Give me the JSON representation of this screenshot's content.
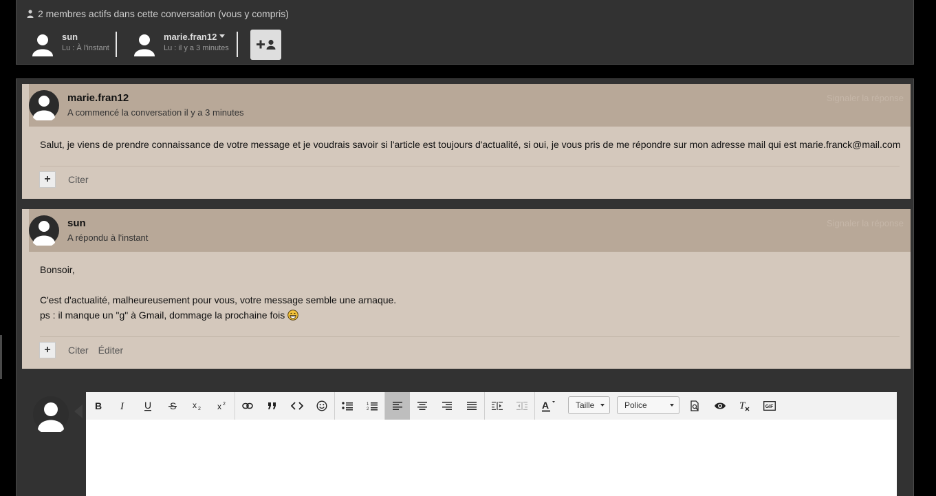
{
  "members": {
    "title": "2 membres actifs dans cette conversation (vous y compris)",
    "list": [
      {
        "name": "sun",
        "read": "Lu : À l'instant"
      },
      {
        "name": "marie.fran12",
        "read": "Lu : il y a 3 minutes"
      }
    ],
    "add_member_icon": "add-user-icon"
  },
  "messages": [
    {
      "author": "marie.fran12",
      "meta": "A commencé la conversation il y a 3 minutes",
      "report": "Signaler la réponse",
      "body": [
        "Salut, je viens de prendre connaissance de votre message et je voudrais savoir si l'article est toujours d'actualité, si oui, je vous pris de me répondre sur mon adresse mail qui est marie.franck@mail.com"
      ],
      "actions": [
        "Citer"
      ]
    },
    {
      "author": "sun",
      "meta": "A répondu à l'instant",
      "report": "Signaler la réponse",
      "body": [
        "Bonsoir,",
        "C'est d'actualité, malheureusement pour vous, votre message semble une arnaque.",
        "ps : il manque un \"g\" à Gmail, dommage la prochaine fois"
      ],
      "actions": [
        "Citer",
        "Éditer"
      ]
    }
  ],
  "editor": {
    "size_select": "Taille",
    "font_select": "Police",
    "gif_label": "GIF",
    "toolbar_icons": [
      "bold-icon",
      "italic-icon",
      "underline-icon",
      "strikethrough-icon",
      "subscript-icon",
      "superscript-icon",
      "link-icon",
      "quote-icon",
      "code-icon",
      "emoji-icon",
      "bullet-list-icon",
      "numbered-list-icon",
      "align-left-icon",
      "align-center-icon",
      "align-right-icon",
      "align-justify-icon",
      "indent-icon",
      "outdent-icon",
      "text-color-icon",
      "preview-icon",
      "view-icon",
      "clear-format-icon",
      "gif-icon"
    ]
  }
}
